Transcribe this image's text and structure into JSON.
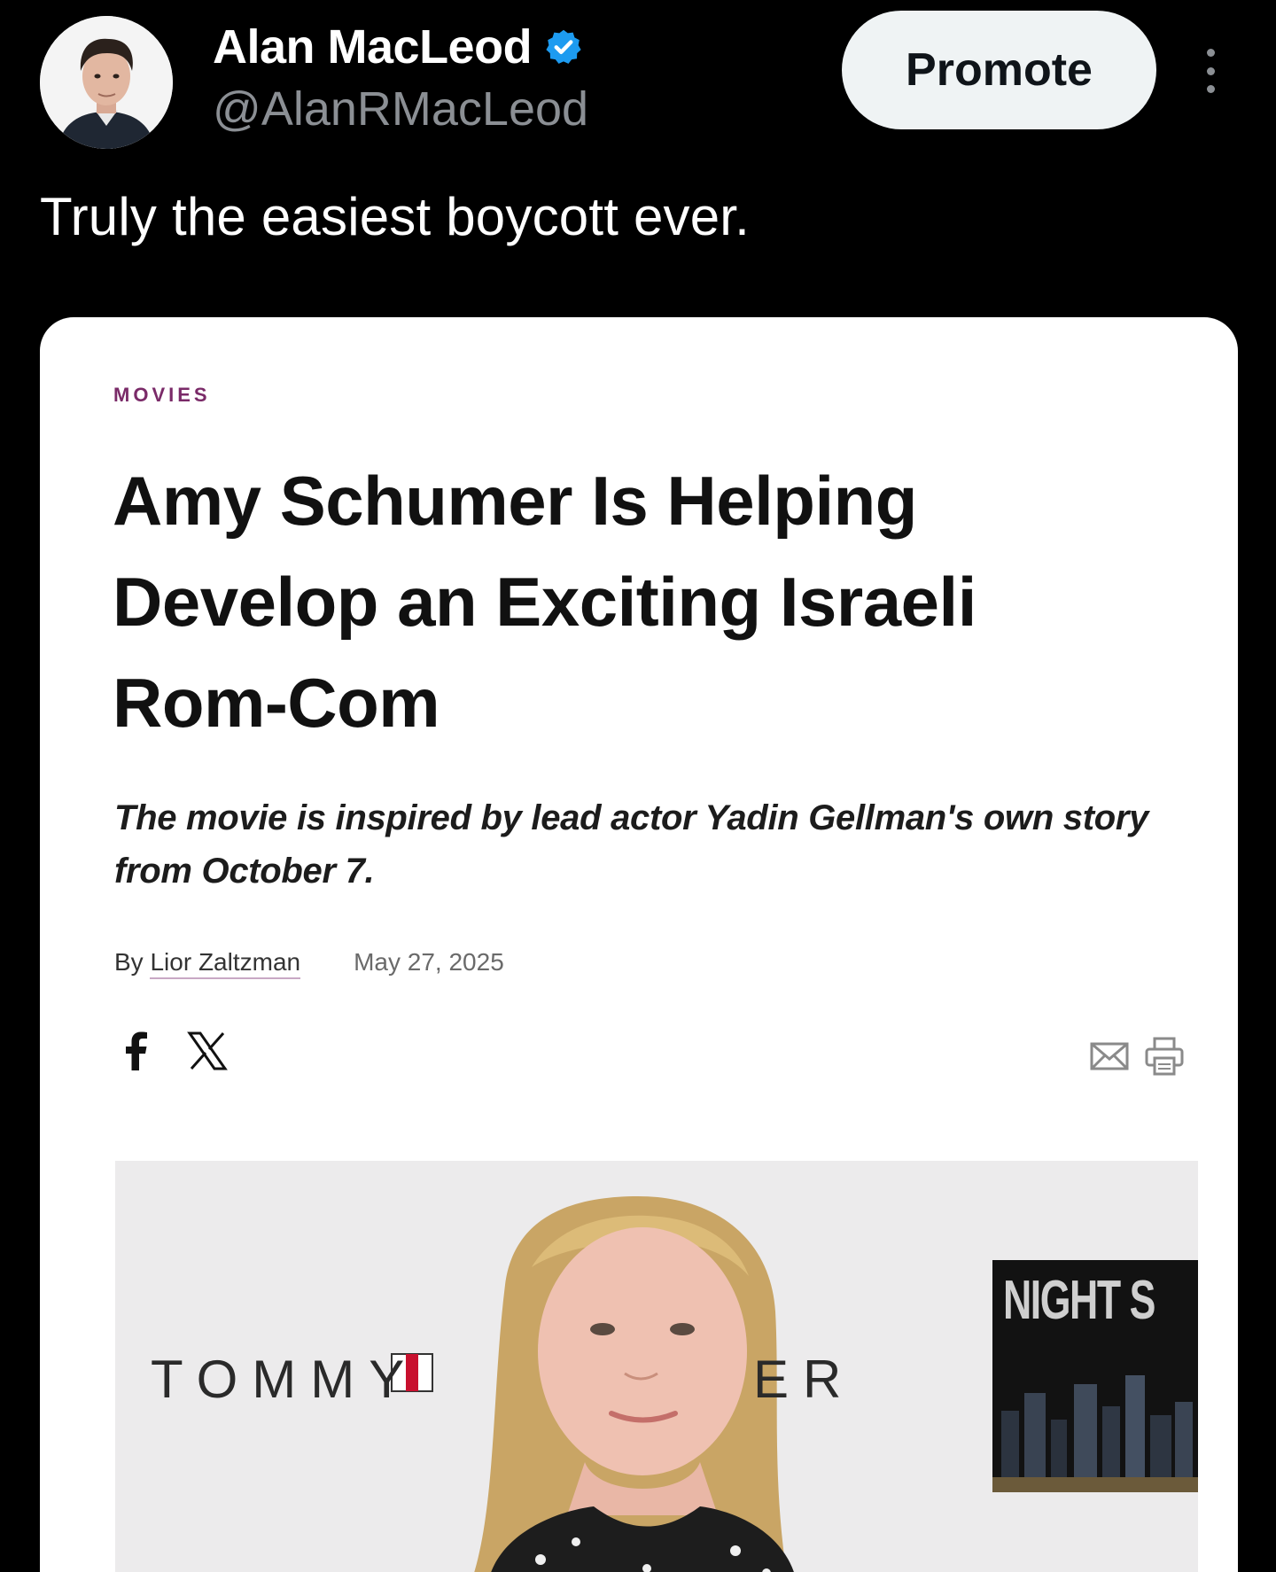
{
  "tweet": {
    "author_name": "Alan MacLeod",
    "author_handle": "@AlanRMacLeod",
    "verified": true,
    "promote_label": "Promote",
    "text": "Truly the easiest boycott ever."
  },
  "article": {
    "kicker": "MOVIES",
    "headline": "Amy Schumer Is Helping Develop an Exciting Israeli Rom-Com",
    "dek": "The movie is inspired by lead actor Yadin Gellman's own story from October 7.",
    "byline_prefix": "By",
    "author": "Lior Zaltzman",
    "date": "May 27, 2025",
    "share_icons": [
      "facebook-icon",
      "x-icon"
    ],
    "tool_icons": [
      "email-icon",
      "print-icon"
    ],
    "photo": {
      "backdrop_text_left": "TOMMY",
      "backdrop_text_right": "ER",
      "sign_text": "NIGHT S"
    }
  },
  "colors": {
    "background": "#000000",
    "card": "#ffffff",
    "kicker": "#7a2a68",
    "verified": "#1d9bf0",
    "handle": "#8b8f94",
    "promote_bg": "#eff3f4"
  }
}
